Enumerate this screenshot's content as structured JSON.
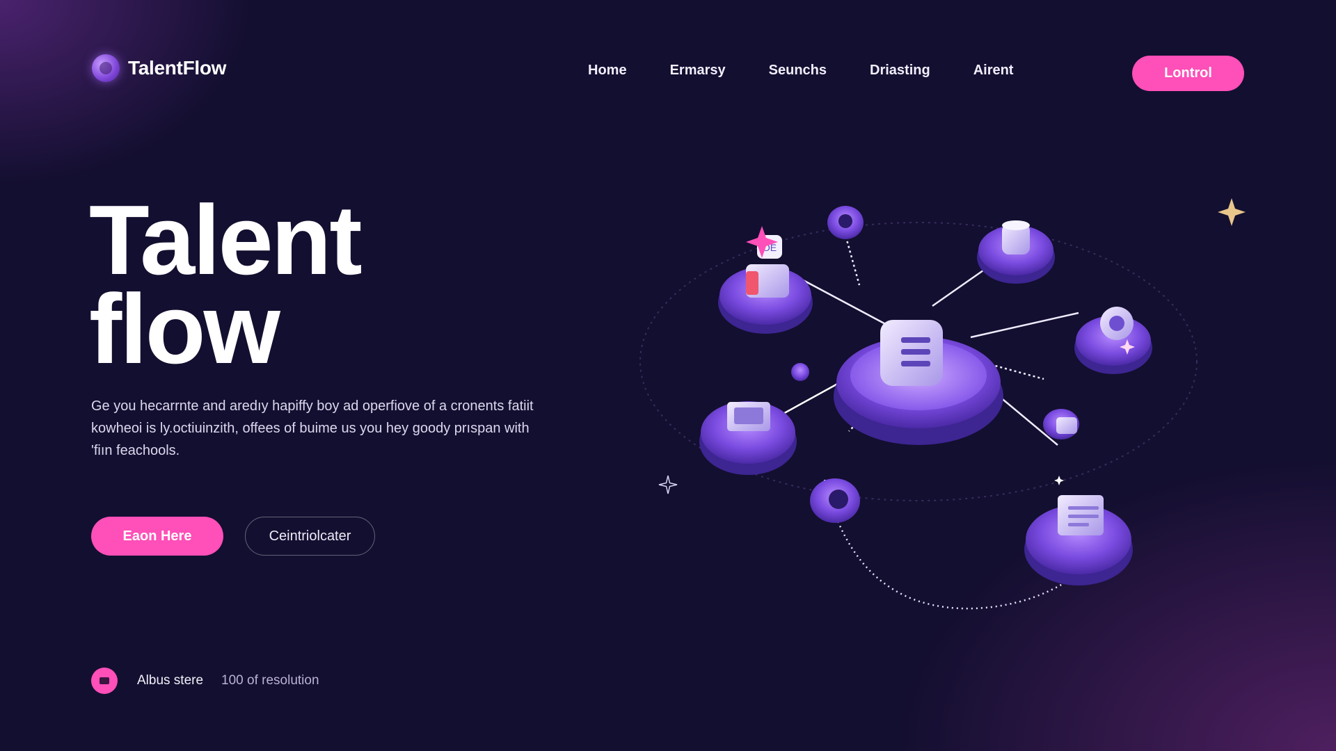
{
  "brand": {
    "name": "TalentFlow",
    "accent": "#ff4fb8",
    "background": "#130f30"
  },
  "nav": {
    "items": [
      "Home",
      "Ermarsy",
      "Seunchs",
      "Driasting",
      "Airent"
    ]
  },
  "header": {
    "cta_label": "Lontrol"
  },
  "hero": {
    "title_line1": "Talent",
    "title_line2": "flow",
    "body": "Ge you hecarrnte and aredıy hapiffy boy ad operfiove of a cronents fatiit kowheoi is ly.octiuinzith, offees of buime us you hey goody prıspan with 'fiın feachools.",
    "primary_label": "Eaon Here",
    "secondary_label": "Ceintriolcater"
  },
  "footer_stat": {
    "label": "Albus stere",
    "value": "100 of resolution"
  },
  "illustration": {
    "icons": [
      "network-hub-icon",
      "database-icon",
      "message-icon",
      "laptop-icon",
      "document-icon",
      "location-icon",
      "sparkle-icon"
    ]
  }
}
